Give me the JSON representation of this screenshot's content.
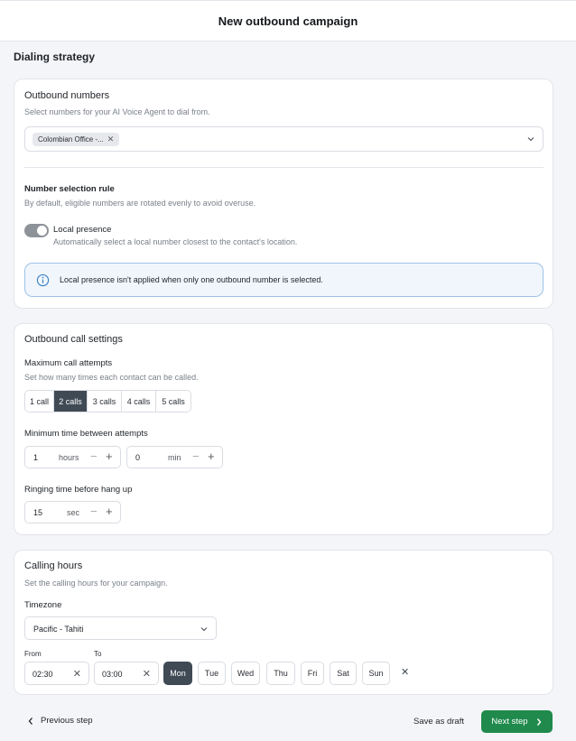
{
  "header": {
    "title": "New outbound campaign"
  },
  "section": {
    "title": "Dialing strategy"
  },
  "outbound_numbers": {
    "title": "Outbound numbers",
    "subtitle": "Select numbers for your AI Voice Agent to dial from.",
    "chip_label": "Colombian Office -...",
    "icons": {
      "chip_remove": "close-icon",
      "dropdown": "chevron-down-icon"
    }
  },
  "number_selection": {
    "title": "Number selection rule",
    "subtitle": "By default, eligible numbers are rotated evenly to avoid overuse.",
    "toggle_label": "Local presence",
    "toggle_description": "Automatically select a local number closest to the contact's location.",
    "toggle_on": true,
    "info_text": "Local presence isn't applied when only one outbound number is selected."
  },
  "call_settings": {
    "title": "Outbound call settings",
    "max_attempts_title": "Maximum call attempts",
    "max_attempts_subtitle": "Set how many times each contact can be called.",
    "options": [
      "1 call",
      "2 calls",
      "3 calls",
      "4 calls",
      "5 calls"
    ],
    "selected_option": "2 calls",
    "min_time_title": "Minimum time between attempts",
    "hours_value": "1",
    "hours_unit": "hours",
    "minutes_value": "0",
    "minutes_unit": "min",
    "ringing_title": "Ringing time before hang up",
    "ringing_value": "15",
    "ringing_unit": "sec"
  },
  "calling_hours": {
    "title": "Calling hours",
    "subtitle": "Set the calling hours for your campaign.",
    "timezone_label": "Timezone",
    "timezone_value": "Pacific - Tahiti",
    "from_label": "From",
    "to_label": "To",
    "from_value": "02:30",
    "to_value": "03:00",
    "days": [
      "Mon",
      "Tue",
      "Wed",
      "Thu",
      "Fri",
      "Sat",
      "Sun"
    ],
    "selected_day": "Mon"
  },
  "footer": {
    "previous_label": "Previous step",
    "draft_label": "Save as draft",
    "next_label": "Next step",
    "accent_color": "#1f8a4c"
  },
  "colors": {
    "selected_fill": "#3f4a55",
    "info_border": "#9ec2e8"
  }
}
